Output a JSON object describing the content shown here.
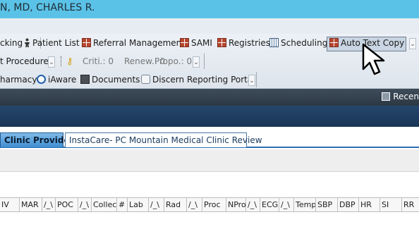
{
  "window": {
    "title": "N, MD, CHARLES R."
  },
  "toolbar1": {
    "items": [
      {
        "label": "cking",
        "icon": "none"
      },
      {
        "label": "Patient List",
        "icon": "person-icon"
      },
      {
        "label": "Referral Management",
        "icon": "grid-icon"
      },
      {
        "label": "SAMI",
        "icon": "grid-icon"
      },
      {
        "label": "Registries",
        "icon": "grid-icon"
      },
      {
        "label": "Scheduling",
        "icon": "calendar-icon"
      },
      {
        "label": "Auto Text Copy",
        "icon": "grid-icon"
      }
    ],
    "overflow": "⌄"
  },
  "toolbar2": {
    "procedures": "t Procedures",
    "criti": "Criti.: 0",
    "renew": "Renew.: 0",
    "propo": "Propo.: 0",
    "overflow": "⌄"
  },
  "toolbar3": {
    "pharmacy": "harmacy",
    "iaware": "iAware",
    "documents": "Documents",
    "discern": "Discern Reporting Portal",
    "overflow": "⌄"
  },
  "darkbar": {
    "recent": "Recen"
  },
  "tabs": [
    {
      "label": "Clinic Provider",
      "active": true
    },
    {
      "label": "InstaCare- PC Mountain Medical Clinic Review",
      "active": false
    }
  ],
  "columns": [
    "IV",
    "MAR",
    "/_\\",
    "POC",
    "/_\\",
    "Collec",
    "#",
    "Lab",
    "/_\\",
    "Rad",
    "/_\\",
    "Proc",
    "NPro",
    "/_\\",
    "ECG",
    "/_\\",
    "Temp",
    "SBP",
    "DBP",
    "HR",
    "SI",
    "RR"
  ],
  "colors": {
    "titlebar": "#5bc2e7",
    "tab_active": "#3f8ed2",
    "navy": "#1a3556"
  }
}
